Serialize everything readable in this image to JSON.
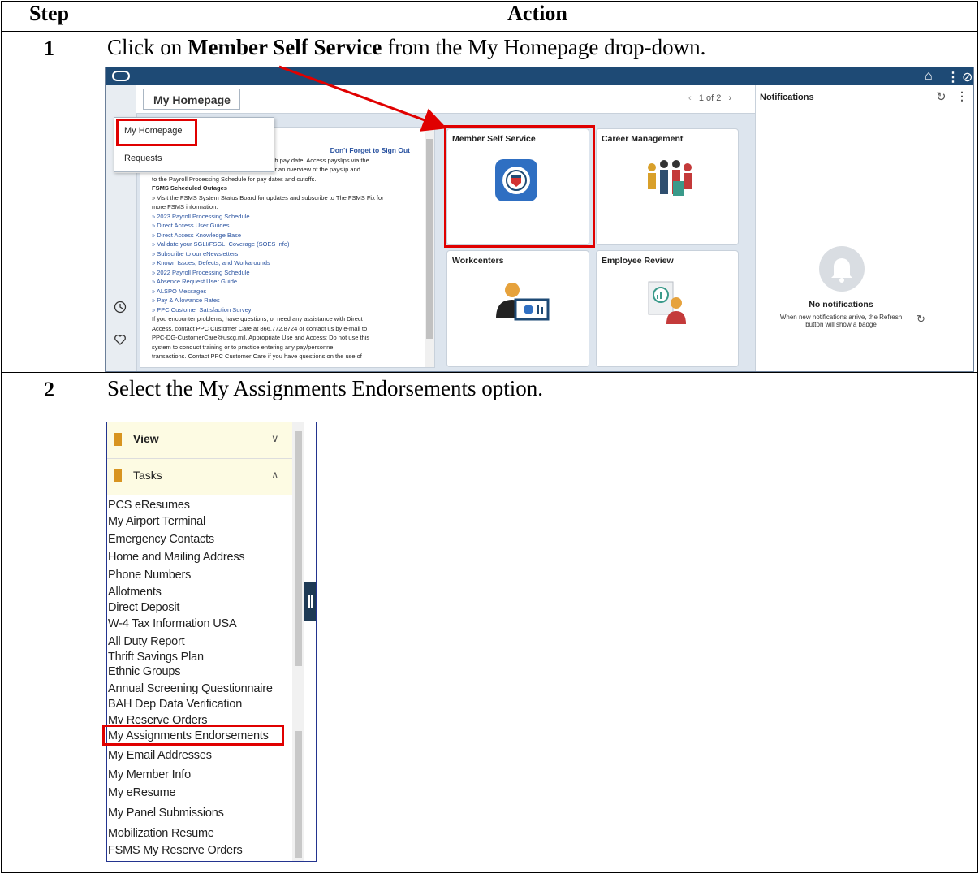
{
  "table": {
    "header": {
      "step": "Step",
      "action": "Action"
    },
    "step1": {
      "number": "1",
      "instruction_pre": "Click on ",
      "instruction_bold": "Member Self Service",
      "instruction_post": " from the My Homepage drop-down."
    },
    "step2": {
      "number": "2",
      "instruction": "Select the My Assignments Endorsements option."
    }
  },
  "shot1": {
    "homepage_button": "My Homepage",
    "pager": "1 of 2",
    "dropdown": [
      "My Homepage",
      "Requests"
    ],
    "news": {
      "title": "Don't Forget to Sign Out",
      "lines": [
        "to each pay date.  Access payslips via the",
        "this guide for an overview of the payslip and",
        "to the Payroll Processing Schedule for pay dates and cutoffs.",
        "FSMS Scheduled Outages",
        "» Visit the  FSMS System Status Board for updates and subscribe to The FSMS Fix for",
        "more FSMS information.",
        "» 2023 Payroll Processing Schedule",
        "» Direct Access User Guides",
        "» Direct Access Knowledge Base",
        "» Validate your SGLI/FSGLI Coverage (SOES Info)",
        "» Subscribe to our eNewsletters",
        "» Known Issues, Defects, and Workarounds",
        "» 2022 Payroll Processing Schedule",
        "» Absence Request User Guide",
        "» ALSPO Messages",
        "» Pay & Allowance Rates",
        "» PPC Customer Satisfaction Survey",
        "If you encounter problems, have questions, or need any assistance with Direct",
        "Access, contact PPC Customer Care at 866.772.8724 or contact us by e-mail to",
        "PPC-DG-CustomerCare@uscg.mil. Appropriate Use and Access: Do not use this",
        "system to conduct training or to practice entering any pay/personnel",
        "transactions. Contact PPC Customer Care if you have questions on the use of"
      ]
    },
    "tiles": [
      "Member Self Service",
      "Career Management",
      "Workcenters",
      "Employee Review"
    ],
    "notifications": {
      "title": "Notifications",
      "empty_title": "No notifications",
      "empty_text_1": "When new notifications arrive, the Refresh",
      "empty_text_2": "button will show a badge"
    }
  },
  "shot2": {
    "sections": [
      {
        "label": "View",
        "chevron": "∨"
      },
      {
        "label": "Tasks",
        "chevron": "∧"
      }
    ],
    "tasks": [
      "PCS eResumes",
      "My Airport Terminal",
      "Emergency Contacts",
      "Home and Mailing Address",
      "Phone Numbers",
      "Allotments",
      "Direct Deposit",
      "W-4 Tax Information USA",
      "All Duty Report",
      "Thrift Savings Plan",
      "Ethnic Groups",
      "Annual Screening Questionnaire",
      "BAH Dep Data Verification",
      "My Reserve Orders",
      "My Assignments Endorsements",
      "My Email Addresses",
      "My Member Info",
      "My eResume",
      "My Panel Submissions",
      "Mobilization Resume",
      "FSMS My Reserve Orders"
    ]
  },
  "colors": {
    "annotation": "#e00000",
    "ps_header": "#1e4a75",
    "link": "#2a53a0"
  }
}
